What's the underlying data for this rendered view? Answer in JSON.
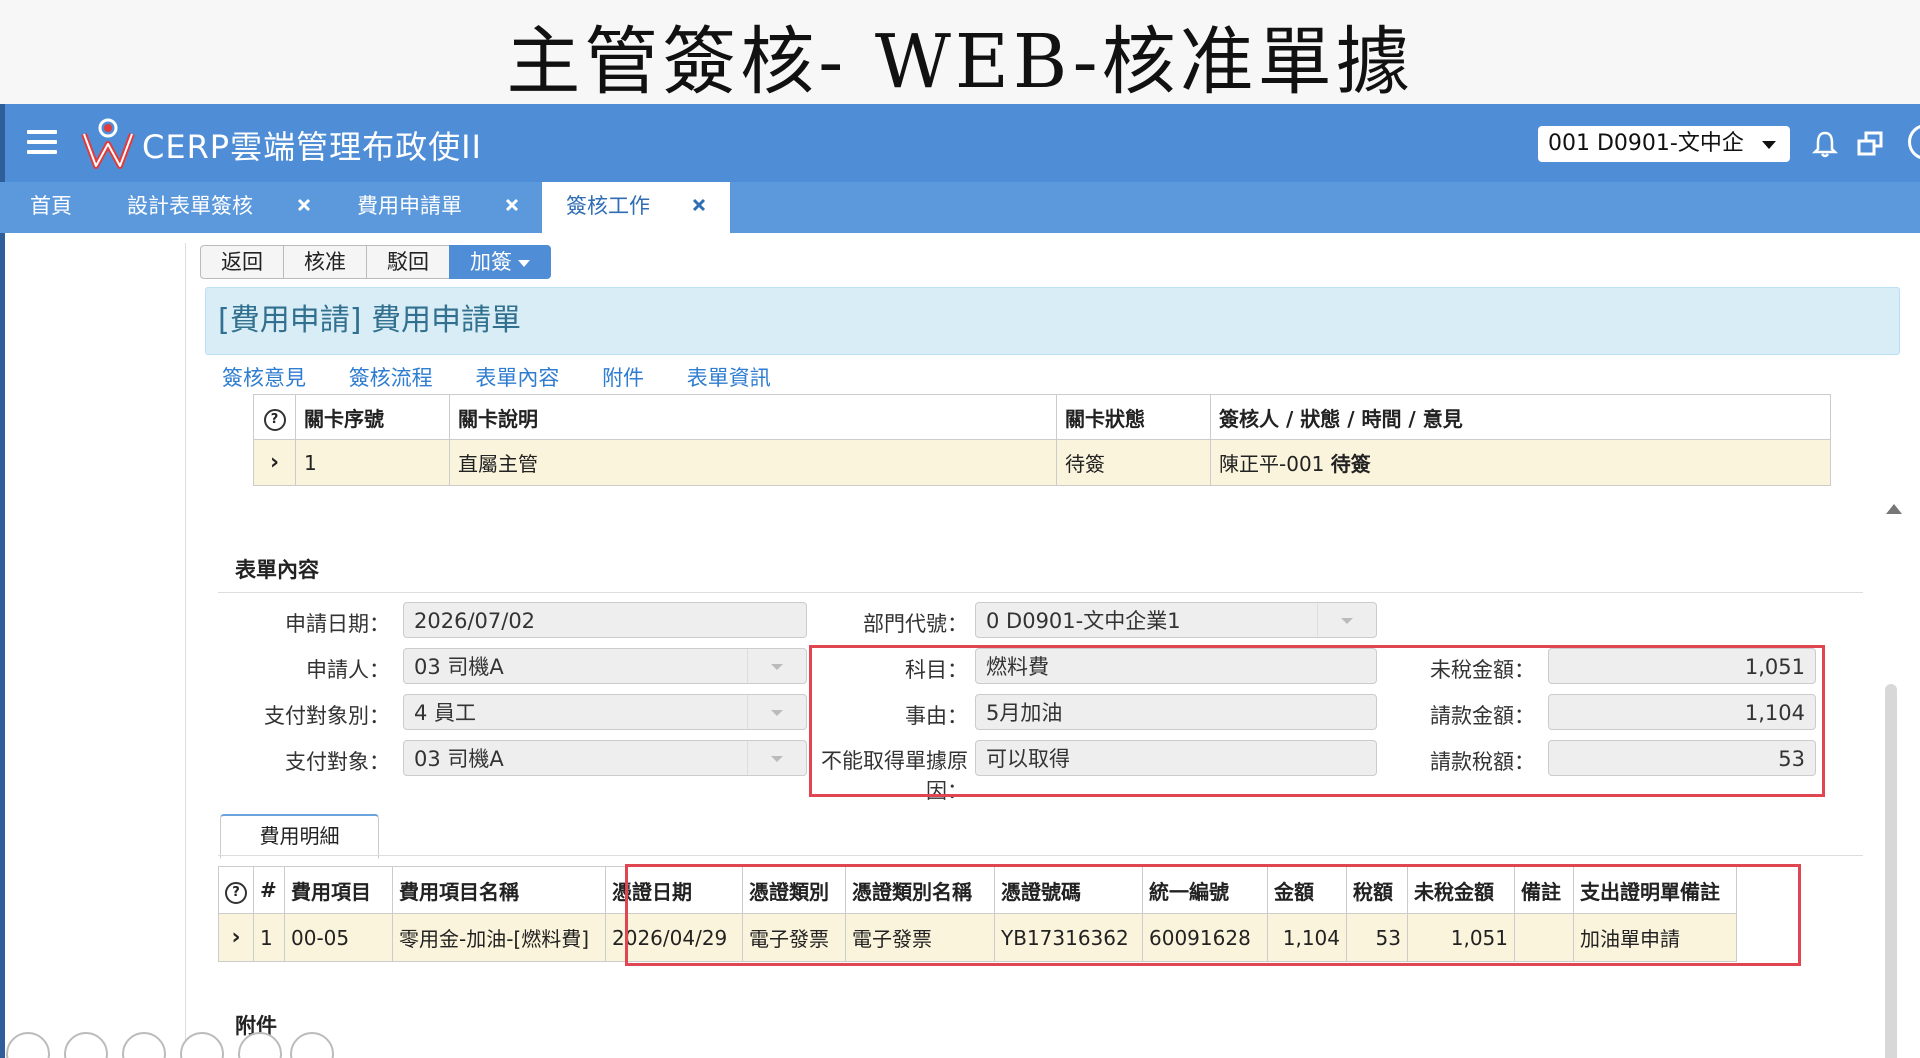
{
  "slide": {
    "title": "主管簽核- WEB-核准單據"
  },
  "header": {
    "app_title": "CERP雲端管理布政使II",
    "company_select": "001 D0901-文中企"
  },
  "tabs": [
    {
      "label": "首頁"
    },
    {
      "label": "設計表單簽核"
    },
    {
      "label": "費用申請單"
    },
    {
      "label": "簽核工作"
    }
  ],
  "toolbar": {
    "back": "返回",
    "approve": "核准",
    "reject": "駁回",
    "countersign": "加簽"
  },
  "form_header": "[費用申請] 費用申請單",
  "links": [
    "簽核意見",
    "簽核流程",
    "表單內容",
    "附件",
    "表單資訊"
  ],
  "flow_table": {
    "columns": [
      "關卡序號",
      "關卡說明",
      "關卡狀態",
      "簽核人 / 狀態 / 時間 / 意見"
    ],
    "rows": [
      {
        "seq": "1",
        "desc": "直屬主管",
        "status": "待簽",
        "signer": "陳正平-001 ",
        "signer_status": "待簽"
      }
    ]
  },
  "form_section_title": "表單內容",
  "form": {
    "apply_date": {
      "label": "申請日期：",
      "value": "2026/07/02"
    },
    "applicant": {
      "label": "申請人：",
      "value": "03 司機A"
    },
    "payee_type": {
      "label": "支付對象別：",
      "value": "4 員工"
    },
    "payee": {
      "label": "支付對象：",
      "value": "03 司機A"
    },
    "dept": {
      "label": "部門代號：",
      "value": "0 D0901-文中企業1"
    },
    "subject": {
      "label": "科目：",
      "value": "燃料費"
    },
    "reason": {
      "label": "事由：",
      "value": "5月加油"
    },
    "no_receipt_reason": {
      "label": "不能取得單據原因：",
      "value": "可以取得"
    },
    "pretax_amount": {
      "label": "未稅金額：",
      "value": "1,051"
    },
    "request_amount": {
      "label": "請款金額：",
      "value": "1,104"
    },
    "request_tax": {
      "label": "請款稅額：",
      "value": "53"
    }
  },
  "detail_tab": "費用明細",
  "detail_table": {
    "columns": [
      "#",
      "費用項目",
      "費用項目名稱",
      "憑證日期",
      "憑證類別",
      "憑證類別名稱",
      "憑證號碼",
      "統一編號",
      "金額",
      "稅額",
      "未稅金額",
      "備註",
      "支出證明單備註"
    ],
    "rows": [
      {
        "no": "1",
        "item": "00-05",
        "item_name": "零用金-加油-[燃料費]",
        "voucher_date": "2026/04/29",
        "voucher_type": "電子發票",
        "voucher_type_name": "電子發票",
        "voucher_no": "YB17316362",
        "tax_id": "60091628",
        "amount": "1,104",
        "tax": "53",
        "pretax": "1,051",
        "note": "",
        "expense_note": "加油單申請"
      }
    ]
  },
  "attachments_title": "附件",
  "colors": {
    "topbar": "#4f8ed6",
    "tabbar": "#5b99dc",
    "highlight_border": "#e04552",
    "row_bg": "#fbf4dc",
    "panel_bg": "#d9edf7"
  }
}
